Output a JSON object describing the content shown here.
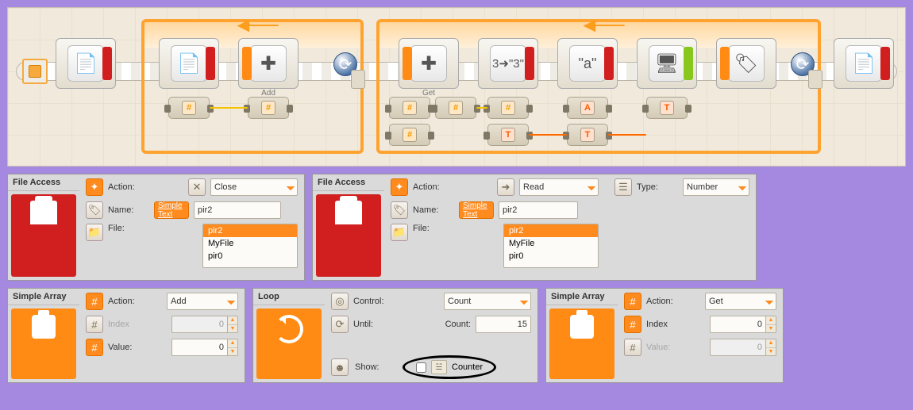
{
  "canvas": {
    "blocks": {
      "file_close_label": "",
      "file_read_label": "",
      "array_add_label": "Add",
      "array_get_label": "Get"
    }
  },
  "panel_file_close": {
    "title": "File Access",
    "action_label": "Action:",
    "action_value": "Close",
    "name_label": "Name:",
    "name_link": "Simple Text",
    "name_value": "pir2",
    "file_label": "File:",
    "file_list": [
      "pir2",
      "MyFile",
      "pir0"
    ],
    "file_selected": "pir2"
  },
  "panel_file_read": {
    "title": "File Access",
    "action_label": "Action:",
    "action_value": "Read",
    "type_label": "Type:",
    "type_value": "Number",
    "name_label": "Name:",
    "name_link": "Simple Text",
    "name_value": "pir2",
    "file_label": "File:",
    "file_list": [
      "pir2",
      "MyFile",
      "pir0"
    ],
    "file_selected": "pir2"
  },
  "panel_array_add": {
    "title": "Simple Array",
    "action_label": "Action:",
    "action_value": "Add",
    "index_label": "Index",
    "index_value": "0",
    "value_label": "Value:",
    "value_value": "0"
  },
  "panel_loop": {
    "title": "Loop",
    "control_label": "Control:",
    "control_value": "Count",
    "until_label": "Until:",
    "count_label": "Count:",
    "count_value": "15",
    "show_label": "Show:",
    "counter_checked": false,
    "counter_label": "Counter"
  },
  "panel_array_get": {
    "title": "Simple Array",
    "action_label": "Action:",
    "action_value": "Get",
    "index_label": "Index",
    "index_value": "0",
    "value_label": "Value:",
    "value_value": "0"
  }
}
